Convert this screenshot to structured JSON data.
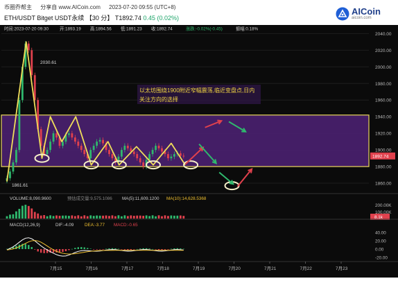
{
  "header": {
    "app_name": "币圈乔帮主",
    "shared_from": "分享自 www.AICoin.com",
    "datetime": "2023-07-20 09:55 (UTC+8)",
    "symbol": "ETH/USDT Bitget USDT永续",
    "interval": "【30 分】",
    "last_price": "T1892.74",
    "change": "0.45 (0.02%)"
  },
  "logo": {
    "name": "AICoin",
    "subtitle": "aicoin.com"
  },
  "ohlc_bar": {
    "time": "时间:2023-07-20 09:30",
    "open": "开:1893.19",
    "high": "高:1894.56",
    "low": "低:1891.23",
    "close": "收:1892.74",
    "change": "涨跌:-0.02%(-0.45)",
    "amplitude": "振幅:0.18%"
  },
  "volume_bar": {
    "volume": "VOLUME:8,090.9600",
    "forecast": "预估成交量:9,575.1086",
    "ma5": "MA(5):11,609.1200",
    "ma10": "MA(10):14,628.5368"
  },
  "macd_bar": {
    "params": "MACD(12,26,9)",
    "dif": "DIF:-4.09",
    "dea": "DEA:-3.77",
    "macd": "MACD:-0.65"
  },
  "annotation": "以太坊围绕1900附近窄幅震荡,临近变盘点,日内关注方向的选择",
  "annotation_lines": [
    "以太坊围绕1900附近窄幅震荡,临近变盘点,日内",
    "关注方向的选择"
  ],
  "price_labels": {
    "high": "2030.61",
    "low": "1861.61",
    "current": "1892.74"
  },
  "volume_labels": {
    "current": "8.1k"
  },
  "colors": {
    "up": "#2fb86d",
    "down": "#e0414d",
    "band_fill": "#4a2070",
    "band_line": "#ecd95a",
    "zigzag": "#f0de5a",
    "ma5": "#ffffff",
    "ma10": "#f2c230",
    "dif": "#ffffff",
    "dea": "#f2c230",
    "accent_current": "#e0414d"
  },
  "chart_data": {
    "type": "candlestick",
    "x_ticks": [
      "7月15",
      "7月16",
      "7月17",
      "7月18",
      "7月19",
      "7月20",
      "7月21",
      "7月22",
      "7月23"
    ],
    "y_ticks": [
      1860,
      1880,
      1900,
      1920,
      1940,
      1960,
      1980,
      2000,
      2020,
      2040
    ],
    "ylim": [
      1850,
      2042
    ],
    "range_band": [
      1880,
      1942
    ],
    "volume_ticks": [
      "200.00K",
      "100.00K"
    ],
    "volume_max": 220000,
    "macd_ticks": [
      40,
      20,
      0,
      -20
    ],
    "macd_ylim": [
      -25,
      45
    ],
    "close_series": [
      1866,
      1874,
      1885,
      1900,
      1960,
      2000,
      2028,
      2020,
      1990,
      1960,
      1925,
      1905,
      1895,
      1900,
      1910,
      1920,
      1915,
      1905,
      1910,
      1918,
      1920,
      1915,
      1910,
      1905,
      1900,
      1895,
      1890,
      1900,
      1905,
      1910,
      1912,
      1908,
      1900,
      1895,
      1890,
      1885,
      1892,
      1900,
      1905,
      1902,
      1898,
      1895,
      1890,
      1885,
      1880,
      1888,
      1895,
      1900,
      1905,
      1902,
      1898,
      1895,
      1890,
      1892,
      1895,
      1896,
      1893,
      1892.74
    ],
    "zigzag_path": [
      [
        0.0,
        1862
      ],
      [
        6.2,
        2030
      ],
      [
        11.3,
        1890
      ],
      [
        14.0,
        1940
      ],
      [
        17.7,
        1910
      ],
      [
        22.2,
        1940
      ],
      [
        27.2,
        1882
      ],
      [
        32.6,
        1910
      ],
      [
        36.2,
        1882
      ],
      [
        41.8,
        1904
      ],
      [
        47.2,
        1882
      ],
      [
        53.0,
        1908
      ],
      [
        57.5,
        1882
      ]
    ],
    "highlight_points": [
      [
        11.3,
        1890
      ],
      [
        27.2,
        1882
      ],
      [
        36.2,
        1882
      ],
      [
        47.2,
        1882
      ],
      [
        59.3,
        1882
      ],
      [
        72.6,
        1857
      ]
    ],
    "arrows": [
      {
        "from": [
          57.6,
          1883
        ],
        "to": [
          63.3,
          1903
        ],
        "color": "#e0414d"
      },
      {
        "from": [
          63.9,
          1927
        ],
        "to": [
          69.2,
          1935
        ],
        "color": "#e0414d"
      },
      {
        "from": [
          71.6,
          1934
        ],
        "to": [
          77.0,
          1922
        ],
        "color": "#2fb86d"
      },
      {
        "from": [
          62.0,
          1907
        ],
        "to": [
          67.5,
          1884
        ],
        "color": "#2fb86d"
      },
      {
        "from": [
          68.5,
          1873
        ],
        "to": [
          73.0,
          1859
        ],
        "color": "#2fb86d"
      },
      {
        "from": [
          74.4,
          1856
        ],
        "to": [
          79.0,
          1877
        ],
        "color": "#e0414d"
      }
    ]
  }
}
